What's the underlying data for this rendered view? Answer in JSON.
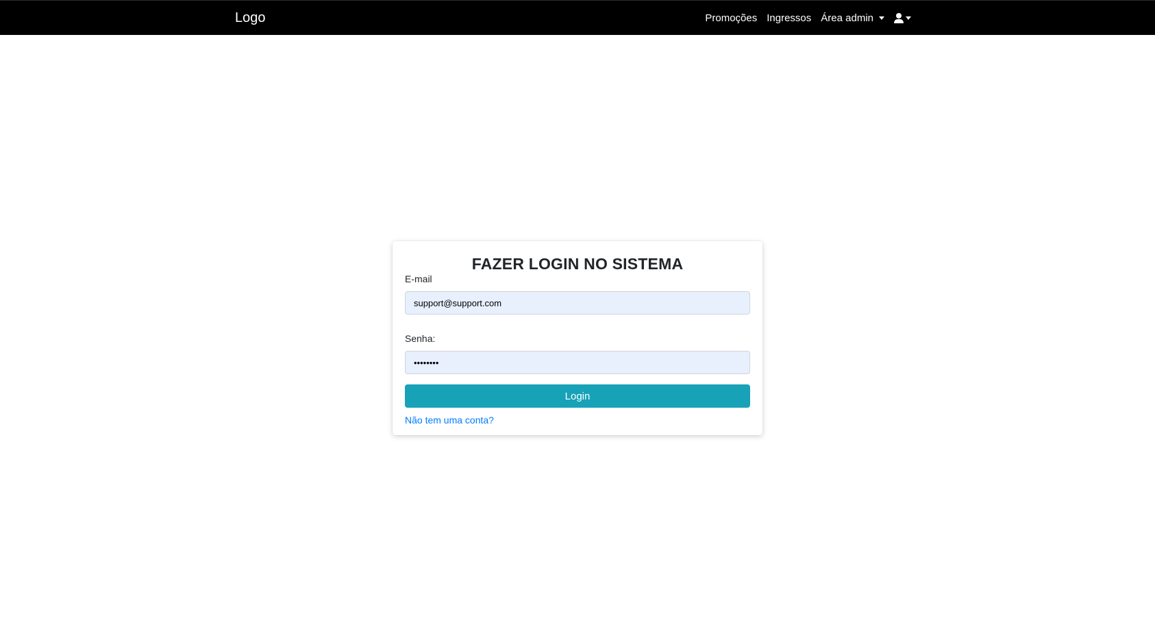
{
  "navbar": {
    "brand": "Logo",
    "links": {
      "promocoes": "Promoções",
      "ingressos": "Ingressos",
      "area_admin": "Área admin"
    },
    "user_icon": "user-icon",
    "background": "#000000"
  },
  "login": {
    "title": "FAZER LOGIN NO SISTEMA",
    "email_label": "E-mail",
    "email_value": "support@support.com",
    "password_label": "Senha:",
    "password_value": "••••••••",
    "submit_label": "Login",
    "signup_link": "Não tem uma conta?"
  },
  "colors": {
    "button": "#17a2b8",
    "link": "#007bff",
    "input_autofill": "#e8f0fe"
  }
}
